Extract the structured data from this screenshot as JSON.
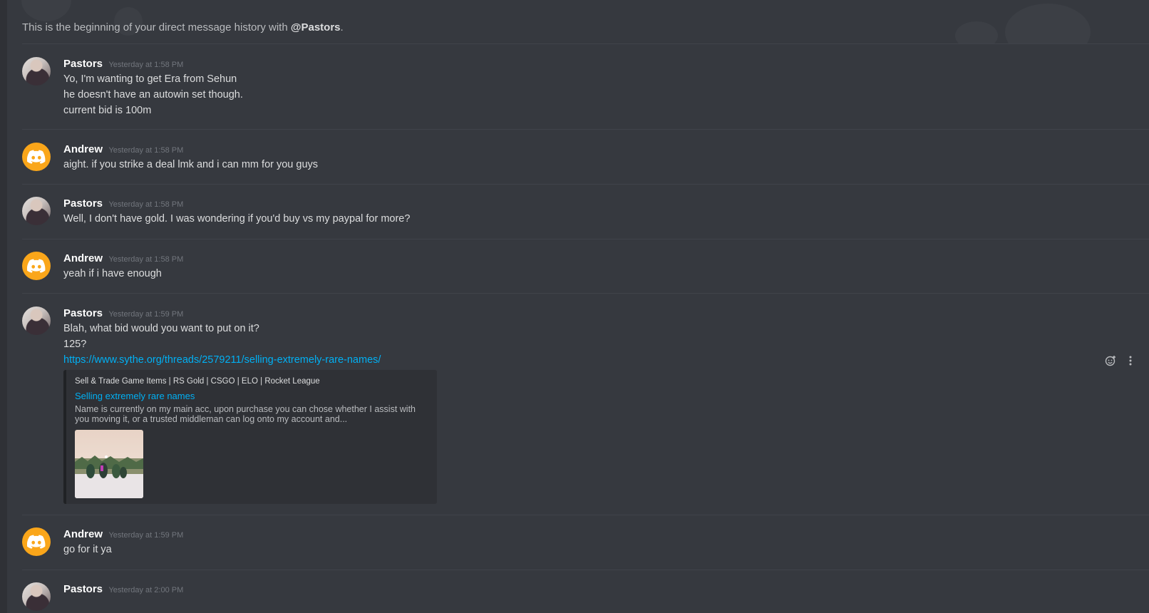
{
  "intro": {
    "prefix": "This is the beginning of your direct message history with ",
    "mention": "@Pastors",
    "suffix": "."
  },
  "colors": {
    "background": "#36393f",
    "rail": "#2f3136",
    "link": "#00b0f4",
    "discord_avatar": "#faa61a"
  },
  "messages": [
    {
      "author": "Pastors",
      "avatar": "photo-avatar",
      "timestamp": "Yesterday at 1:58 PM",
      "lines": [
        "Yo, I'm wanting to get Era from Sehun",
        "he doesn't have an autowin set though.",
        "current bid is 100m"
      ]
    },
    {
      "author": "Andrew",
      "avatar": "discord-logo-icon",
      "timestamp": "Yesterday at 1:58 PM",
      "lines": [
        "aight. if you strike a deal lmk and i can mm for you guys"
      ]
    },
    {
      "author": "Pastors",
      "avatar": "photo-avatar",
      "timestamp": "Yesterday at 1:58 PM",
      "lines": [
        "Well, I don't have gold. I was wondering if you'd buy vs my paypal for more?"
      ]
    },
    {
      "author": "Andrew",
      "avatar": "discord-logo-icon",
      "timestamp": "Yesterday at 1:58 PM",
      "lines": [
        "yeah if i have enough"
      ]
    },
    {
      "author": "Pastors",
      "avatar": "photo-avatar",
      "timestamp": "Yesterday at 1:59 PM",
      "lines": [
        "Blah, what bid would you want to put on it?",
        "125?"
      ],
      "link": "https://www.sythe.org/threads/2579211/selling-extremely-rare-names/",
      "embed": {
        "provider": "Sell & Trade Game Items | RS Gold | CSGO | ELO | Rocket League",
        "title": "Selling extremely rare names",
        "description": "Name is currently on my main acc, upon purchase you can chose whether I assist with you moving it, or a trusted middleman can log onto my account and..."
      }
    },
    {
      "author": "Andrew",
      "avatar": "discord-logo-icon",
      "timestamp": "Yesterday at 1:59 PM",
      "lines": [
        "go for it ya"
      ]
    },
    {
      "author": "Pastors",
      "avatar": "photo-avatar",
      "timestamp": "Yesterday at 2:00 PM",
      "lines": []
    }
  ],
  "hover_tools": {
    "icons": [
      "add-reaction-icon",
      "more-options-icon"
    ]
  }
}
